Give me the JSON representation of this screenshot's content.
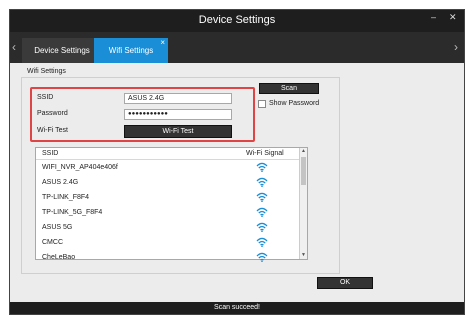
{
  "window": {
    "title": "Device Settings",
    "minimize": "–",
    "close": "✕"
  },
  "tabs": {
    "left_arrow": "‹",
    "right_arrow": "›",
    "items": [
      {
        "label": "Device Settings",
        "active": false
      },
      {
        "label": "Wifi Settings",
        "active": true
      }
    ],
    "close": "×"
  },
  "wifi_settings": {
    "group_label": "Wifi Settings",
    "ssid_label": "SSID",
    "ssid_value": "ASUS 2.4G",
    "password_label": "Password",
    "password_value": "●●●●●●●●●●●",
    "wifi_test_label": "Wi-Fi Test",
    "wifi_test_button": "Wi-Fi Test",
    "scan_button": "Scan",
    "show_password_label": "Show Password"
  },
  "network_table": {
    "headers": [
      "SSID",
      "Wi-Fi Signal"
    ],
    "rows": [
      {
        "ssid": "WIFI_NVR_AP404e406f",
        "signal": "wifi-signal-icon"
      },
      {
        "ssid": "ASUS 2.4G",
        "signal": "wifi-signal-icon"
      },
      {
        "ssid": "TP-LINK_F8F4",
        "signal": "wifi-signal-icon"
      },
      {
        "ssid": "TP-LINK_5G_F8F4",
        "signal": "wifi-signal-icon"
      },
      {
        "ssid": "ASUS 5G",
        "signal": "wifi-signal-icon"
      },
      {
        "ssid": "CMCC",
        "signal": "wifi-signal-icon"
      },
      {
        "ssid": "CheLeBao",
        "signal": "wifi-signal-icon"
      }
    ]
  },
  "ok_button": "OK",
  "status_text": "Scan succeed!",
  "colors": {
    "accent": "#1a8fd8",
    "highlight_border": "#e04545",
    "dark": "#1e1e1e"
  }
}
